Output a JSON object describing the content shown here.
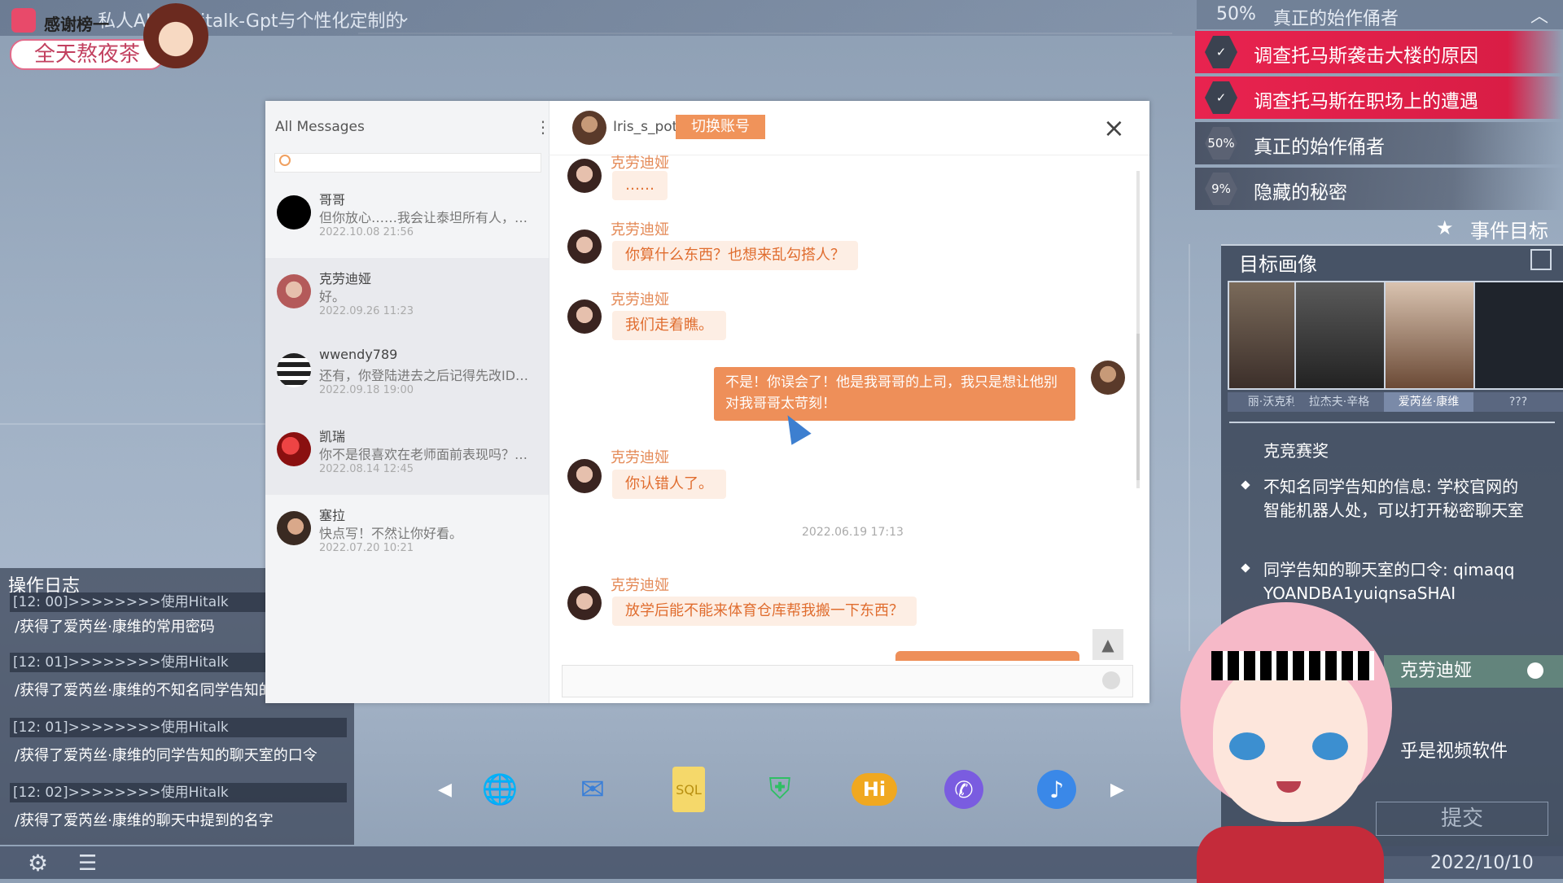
{
  "top_bar": {
    "title": "私人AI管理Hitalk-Gpt与个性化定制的"
  },
  "sticker": {
    "top_text": "感谢榜一",
    "label": "全天熬夜茶"
  },
  "mission": {
    "header_percent": "50%",
    "header_title": "真正的始作俑者",
    "items": [
      {
        "status": "done",
        "badge": "✓",
        "text": "调查托马斯袭击大楼的原因"
      },
      {
        "status": "done",
        "badge": "✓",
        "text": "调查托马斯在职场上的遭遇"
      },
      {
        "status": "progress",
        "badge": "50%",
        "text": "真正的始作俑者"
      },
      {
        "status": "progress",
        "badge": "9%",
        "text": "隐藏的秘密"
      }
    ],
    "event_goal_label": "事件目标"
  },
  "targets": {
    "title": "目标画像",
    "portraits": [
      {
        "name": "丽·沃克利"
      },
      {
        "name": "拉杰夫·辛格"
      },
      {
        "name": "爱芮丝·康维"
      },
      {
        "name": "???"
      }
    ],
    "clues": [
      "克竞赛奖",
      "不知名同学告知的信息: 学校官网的智能机器人处，可以打开秘密聊天室",
      "同学告知的聊天室的口令: qimaqqYOANDBA1yuiqnsaSHAI"
    ],
    "answer1": "克劳迪娅",
    "answer2": "乎是视频软件",
    "submit_label": "提交"
  },
  "log": {
    "title": "操作日志",
    "entries": [
      {
        "head": "[12: 00]>>>>>>>>使用Hitalk",
        "body": "/获得了爱芮丝·康维的常用密码"
      },
      {
        "head": "[12: 01]>>>>>>>>使用Hitalk",
        "body": "/获得了爱芮丝·康维的不知名同学告知的"
      },
      {
        "head": "[12: 01]>>>>>>>>使用Hitalk",
        "body": "/获得了爱芮丝·康维的同学告知的聊天室的口令"
      },
      {
        "head": "[12: 02]>>>>>>>>使用Hitalk",
        "body": "/获得了爱芮丝·康维的聊天中提到的名字"
      }
    ]
  },
  "date": "2022/10/10",
  "messenger": {
    "sidebar_title": "All Messages",
    "conversations": [
      {
        "name": "哥哥",
        "preview": "但你放心……我会让泰坦所有人，…",
        "time": "2022.10.08 21:56",
        "avatar_color": "#000000"
      },
      {
        "name": "克劳迪娅",
        "preview": "好。",
        "time": "2022.09.26 11:23",
        "avatar_color": "#b45a5a"
      },
      {
        "name": "wwendy789",
        "preview": "还有，你登陆进去之后记得先改ID…",
        "time": "2022.09.18 19:00",
        "avatar_color": "#555555"
      },
      {
        "name": "凯瑞",
        "preview": "你不是很喜欢在老师面前表现吗？…",
        "time": "2022.08.14 12:45",
        "avatar_color": "#c0202a"
      },
      {
        "name": "塞拉",
        "preview": "快点写！不然让你好看。",
        "time": "2022.07.20 10:21",
        "avatar_color": "#3a2a22"
      }
    ],
    "chat": {
      "username": "Iris_s_pot",
      "switch_label": "切换账号",
      "close_glyph": "×",
      "messages": [
        {
          "sender": "克劳迪娅",
          "text": "……"
        },
        {
          "sender": "克劳迪娅",
          "text": "你算什么东西？也想来乱勾搭人？"
        },
        {
          "sender": "克劳迪娅",
          "text": "我们走着瞧。"
        },
        {
          "sender": "me",
          "text": "不是！你误会了！他是我哥哥的上司，我只是想让他别对我哥哥太苛刻！"
        },
        {
          "sender": "克劳迪娅",
          "text": "你认错人了。"
        },
        {
          "sender": "克劳迪娅",
          "text": "放学后能不能来体育仓库帮我搬一下东西？"
        }
      ],
      "timestamp": "2022.06.19 17:13"
    }
  },
  "dock": {
    "left_arrow": "◀",
    "right_arrow": "▶",
    "apps": [
      {
        "name": "browser-icon",
        "glyph": "🌐",
        "color": "#3b9ae0"
      },
      {
        "name": "mail-icon",
        "glyph": "✉",
        "color": "#3a7fd8"
      },
      {
        "name": "sql-file-icon",
        "glyph": "SQL",
        "color": "#e8c040"
      },
      {
        "name": "shield-icon",
        "glyph": "⛨",
        "color": "#2fbf64"
      },
      {
        "name": "hitalk-icon",
        "glyph": "Hi",
        "color": "#f0a820"
      },
      {
        "name": "phone-icon",
        "glyph": "✆",
        "color": "#7a5ce0"
      },
      {
        "name": "music-icon",
        "glyph": "♪",
        "color": "#3a88e8"
      }
    ]
  }
}
